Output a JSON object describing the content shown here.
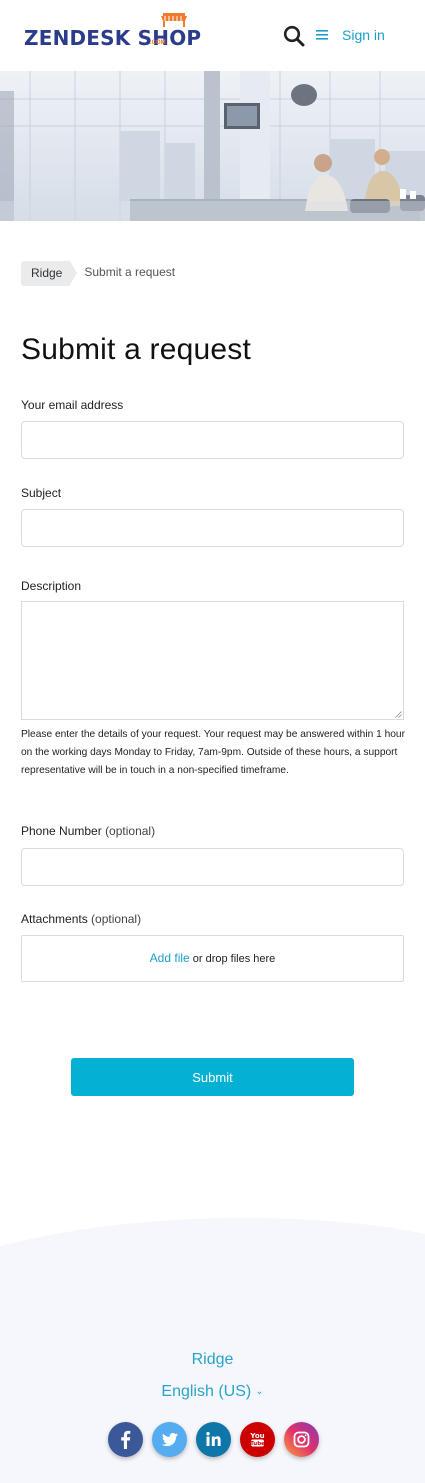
{
  "header": {
    "logo_text_left": "ZENDESK S",
    "logo_text_right": "OP",
    "logo_sub": ".COM",
    "signin_label": "Sign in"
  },
  "breadcrumb": {
    "items": [
      {
        "label": "Ridge"
      },
      {
        "label": "Submit a request"
      }
    ]
  },
  "page": {
    "title": "Submit a request"
  },
  "form": {
    "email": {
      "label": "Your email address",
      "value": ""
    },
    "subject": {
      "label": "Subject",
      "value": ""
    },
    "description": {
      "label": "Description",
      "value": "",
      "help": "Please enter the details of your request. Your request may be answered within 1 hour on the working days Monday to Friday, 7am-9pm. Outside of these hours, a support representative will be in touch in a non-specified timeframe."
    },
    "phone": {
      "label": "Phone Number",
      "optional": "(optional)",
      "value": ""
    },
    "attachments": {
      "label": "Attachments",
      "optional": "(optional)",
      "add_file": "Add file",
      "drop_text": " or drop files here"
    },
    "submit_label": "Submit"
  },
  "footer": {
    "brand": "Ridge",
    "language": "English (US)",
    "social": [
      {
        "name": "facebook",
        "color": "#3b5998"
      },
      {
        "name": "twitter",
        "color": "#55acee"
      },
      {
        "name": "linkedin",
        "color": "#0e76a8"
      },
      {
        "name": "youtube",
        "color": "#cc0000"
      },
      {
        "name": "instagram",
        "color": "#c13584"
      }
    ]
  },
  "colors": {
    "accent": "#1a9fc8",
    "submit_bg": "#04b1d4",
    "logo_blue": "#2c3c8c",
    "logo_orange": "#f07b2d"
  }
}
